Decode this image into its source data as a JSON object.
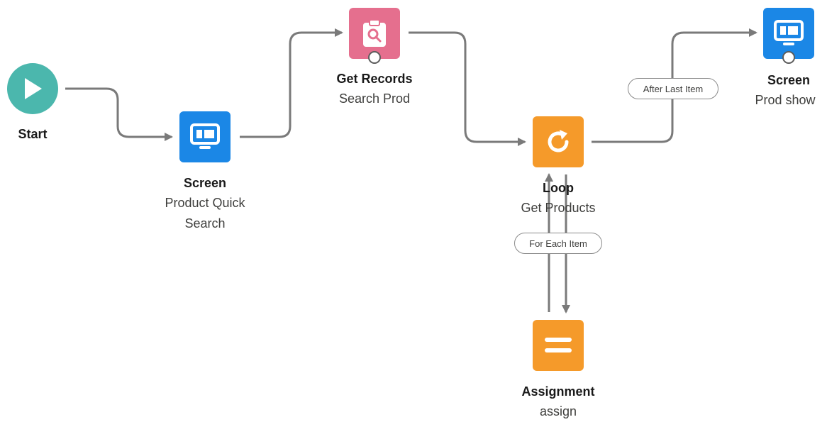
{
  "nodes": {
    "start": {
      "title": "Start",
      "icon": "play-icon",
      "color": "#4bb7ad"
    },
    "screen1": {
      "title": "Screen",
      "subtitle": "Product Quick Search",
      "icon": "screen-icon",
      "color": "#1b87e6"
    },
    "get_records": {
      "title": "Get Records",
      "subtitle": "Search Prod",
      "icon": "clipboard-search-icon",
      "color": "#e56f8e"
    },
    "loop": {
      "title": "Loop",
      "subtitle": "Get Products",
      "icon": "loop-icon",
      "color": "#f59a2a"
    },
    "assignment": {
      "title": "Assignment",
      "subtitle": "assign",
      "icon": "equals-icon",
      "color": "#f59a2a"
    },
    "screen2": {
      "title": "Screen",
      "subtitle": "Prod show",
      "icon": "screen-icon",
      "color": "#1b87e6"
    }
  },
  "connectors": {
    "after_last_item": "After Last Item",
    "for_each_item": "For Each Item"
  }
}
